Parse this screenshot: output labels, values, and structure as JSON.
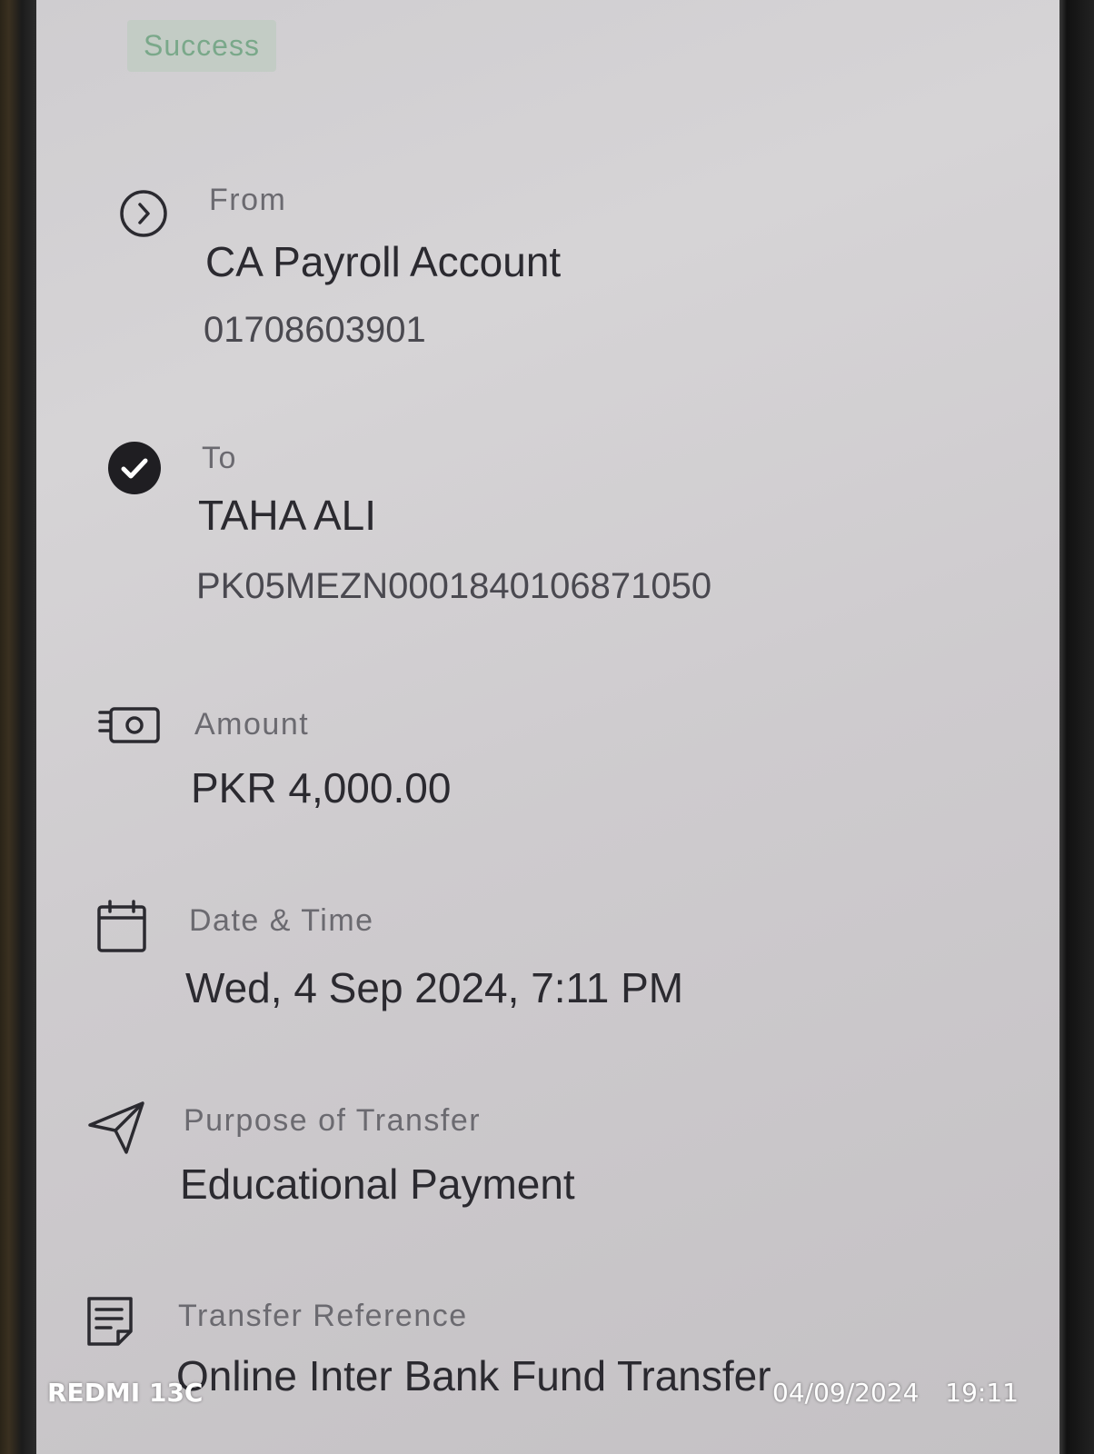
{
  "status": {
    "label": "Success",
    "color": "#7aa88a"
  },
  "details": {
    "from": {
      "label": "From",
      "value": "CA Payroll Account",
      "account": "01708603901",
      "icon": "chevron-right-circle-icon"
    },
    "to": {
      "label": "To",
      "value": "TAHA ALI",
      "account": "PK05MEZN0001840106871050",
      "icon": "check-circle-icon"
    },
    "amount": {
      "label": "Amount",
      "value": "PKR 4,000.00",
      "icon": "cash-icon"
    },
    "datetime": {
      "label": "Date & Time",
      "value": "Wed, 4 Sep 2024, 7:11 PM",
      "icon": "calendar-icon"
    },
    "purpose": {
      "label": "Purpose of Transfer",
      "value": "Educational Payment",
      "icon": "send-icon"
    },
    "reference": {
      "label": "Transfer Reference",
      "value": "Online Inter Bank Fund Transfer",
      "icon": "document-icon"
    }
  },
  "camera_watermark": {
    "device": "REDMI 13C",
    "date": "04/09/2024",
    "time": "19:11"
  }
}
